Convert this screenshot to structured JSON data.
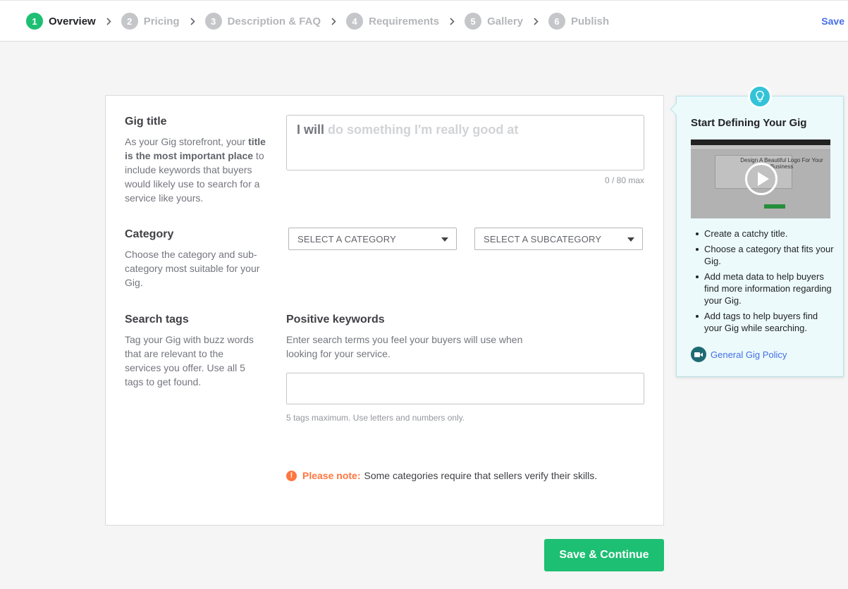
{
  "stepper": {
    "steps": [
      {
        "num": "1",
        "label": "Overview",
        "active": true
      },
      {
        "num": "2",
        "label": "Pricing",
        "active": false
      },
      {
        "num": "3",
        "label": "Description & FAQ",
        "active": false
      },
      {
        "num": "4",
        "label": "Requirements",
        "active": false
      },
      {
        "num": "5",
        "label": "Gallery",
        "active": false
      },
      {
        "num": "6",
        "label": "Publish",
        "active": false
      }
    ],
    "save_label": "Save"
  },
  "gig_title": {
    "heading": "Gig title",
    "desc_1": "As your Gig storefront, your ",
    "desc_bold": "title is the most important place",
    "desc_2": " to include keywords that buyers would likely use to search for a service like yours.",
    "prefix": "I will",
    "placeholder": "do something I'm really good at",
    "counter": "0 / 80 max"
  },
  "category": {
    "heading": "Category",
    "desc": "Choose the category and sub-category most suitable for your Gig.",
    "category_select": "SELECT A CATEGORY",
    "subcategory_select": "SELECT A SUBCATEGORY"
  },
  "search_tags": {
    "heading": "Search tags",
    "desc": "Tag your Gig with buzz words that are relevant to the services you offer. Use all 5 tags to get found.",
    "keywords_heading": "Positive keywords",
    "keywords_desc": "Enter search terms you feel your buyers will use when looking for your service.",
    "hint": "5 tags maximum. Use letters and numbers only."
  },
  "note": {
    "icon": "!",
    "label": "Please note:",
    "text": "Some categories require that sellers verify their skills."
  },
  "save_continue_label": "Save & Continue",
  "tips": {
    "title": "Start Defining Your Gig",
    "video_text": "Design A Beautiful Logo For Your Business",
    "items": [
      "Create a catchy title.",
      "Choose a category that fits your Gig.",
      "Add meta data to help buyers find more information regarding your Gig.",
      "Add tags to help buyers find your Gig while searching."
    ],
    "policy_label": "General Gig Policy"
  },
  "colors": {
    "accent_green": "#1dbf73",
    "link_blue": "#446ee7",
    "note_orange": "#ff7640",
    "tip_cyan": "#33c3d8"
  }
}
